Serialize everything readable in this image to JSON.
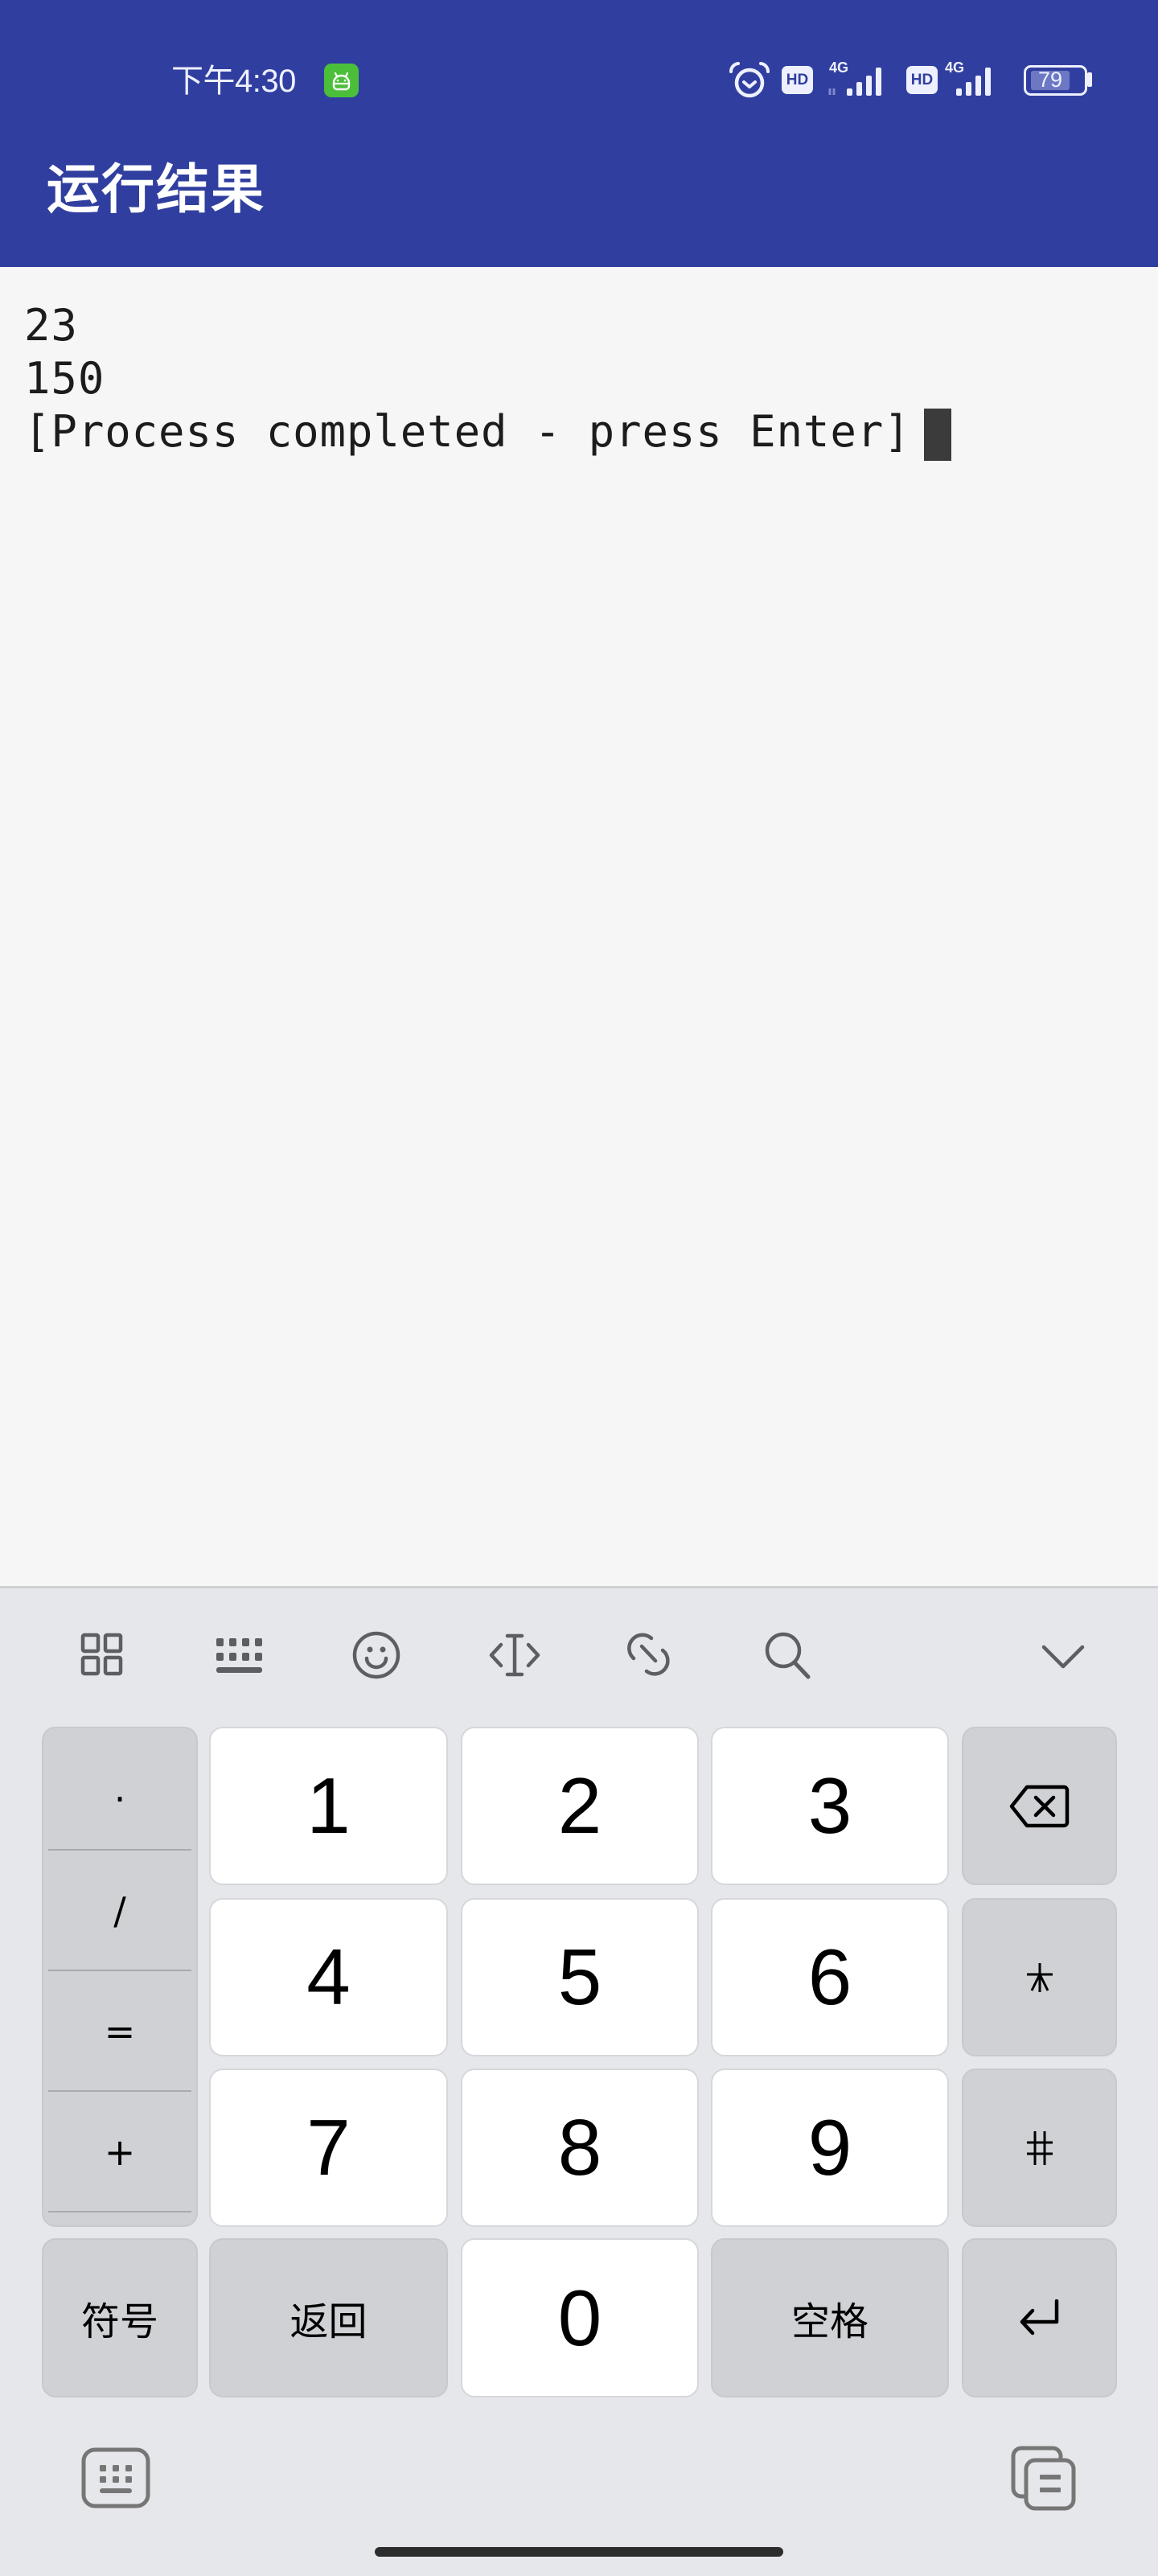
{
  "status_bar": {
    "time": "下午4:30",
    "app_badge_icon": "android-face-icon",
    "icons": [
      "alarm-icon",
      "hd-icon",
      "signal-4g-icon",
      "hd-icon",
      "signal-4g-icon",
      "battery-icon"
    ],
    "hd_label": "HD",
    "network_label": "4G",
    "battery_level": "79",
    "badge_color": "#4cbf3a"
  },
  "app_bar": {
    "title": "运行结果",
    "color": "#303f9f"
  },
  "console": {
    "lines": [
      "23",
      "150",
      "[Process completed - press Enter]"
    ]
  },
  "keyboard": {
    "toolbar": [
      "grid-icon",
      "keyboard-layout-icon",
      "emoji-icon",
      "text-cursor-icon",
      "link-icon",
      "search-icon",
      "chevron-down-icon"
    ],
    "side_keys": [
      ".",
      "/",
      "=",
      "+"
    ],
    "digits": [
      "1",
      "2",
      "3",
      "4",
      "5",
      "6",
      "7",
      "8",
      "9",
      "0"
    ],
    "right_keys": {
      "backspace": "backspace-icon",
      "asterisk": "*",
      "hash": "#",
      "enter": "enter-icon"
    },
    "symbols_label": "符号",
    "back_label": "返回",
    "space_label": "空格",
    "bottom": [
      "keyboard-switch-icon",
      "clipboard-icon"
    ]
  }
}
